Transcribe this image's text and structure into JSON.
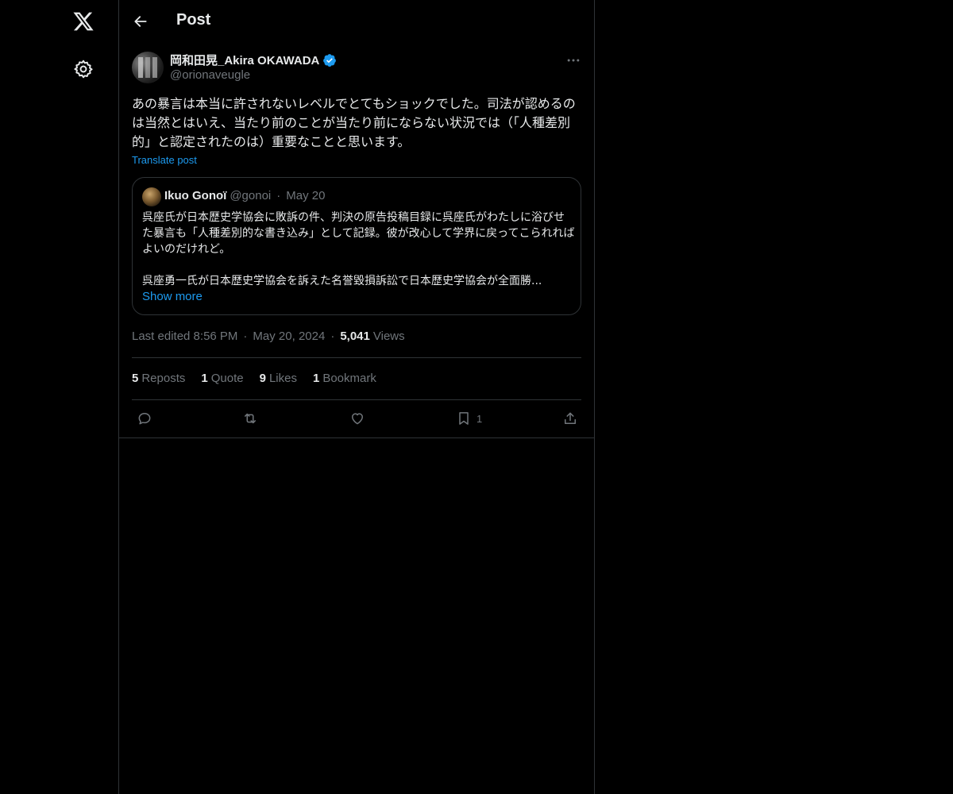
{
  "nav": {
    "logo_icon": "x-logo-icon",
    "settings_icon": "gear-icon"
  },
  "header": {
    "title": "Post",
    "back_icon": "arrow-left-icon"
  },
  "post": {
    "author_name": "岡和田晃_Akira OKAWADA",
    "author_handle": "@orionaveugle",
    "verified_color": "#1d9bf0",
    "text": "あの暴言は本当に許されないレベルでとてもショックでした。司法が認めるのは当然とはいえ、当たり前のことが当たり前にならない状況では（「人種差別的」と認定されたのは）重要なことと思います。",
    "translate_label": "Translate post",
    "quote": {
      "name": "Ikuo Gonoï",
      "handle": "@gonoi",
      "dot": "·",
      "date": "May 20",
      "text": "呉座氏が日本歴史学協会に敗訴の件、判決の原告投稿目録に呉座氏がわたしに浴びせた暴言も「人種差別的な書き込み」として記録。彼が改心して学界に戻ってこられればよいのだけれど。",
      "text2": "呉座勇一氏が日本歴史学協会を訴えた名誉毀損訴訟で日本歴史学協会が全面勝...",
      "show_more": "Show more"
    },
    "meta": {
      "edited": "Last edited 8:56 PM",
      "sep": "·",
      "date": "May 20, 2024",
      "views_count": "5,041",
      "views_label": "Views"
    },
    "stats": [
      {
        "num": "5",
        "label": "Reposts"
      },
      {
        "num": "1",
        "label": "Quote"
      },
      {
        "num": "9",
        "label": "Likes"
      },
      {
        "num": "1",
        "label": "Bookmark"
      }
    ],
    "actions": {
      "bookmark_count": "1"
    }
  },
  "colors": {
    "background": "#000000",
    "text": "#e7e9ea",
    "muted": "#71767b",
    "accent": "#1d9bf0",
    "border": "#2f3336"
  }
}
